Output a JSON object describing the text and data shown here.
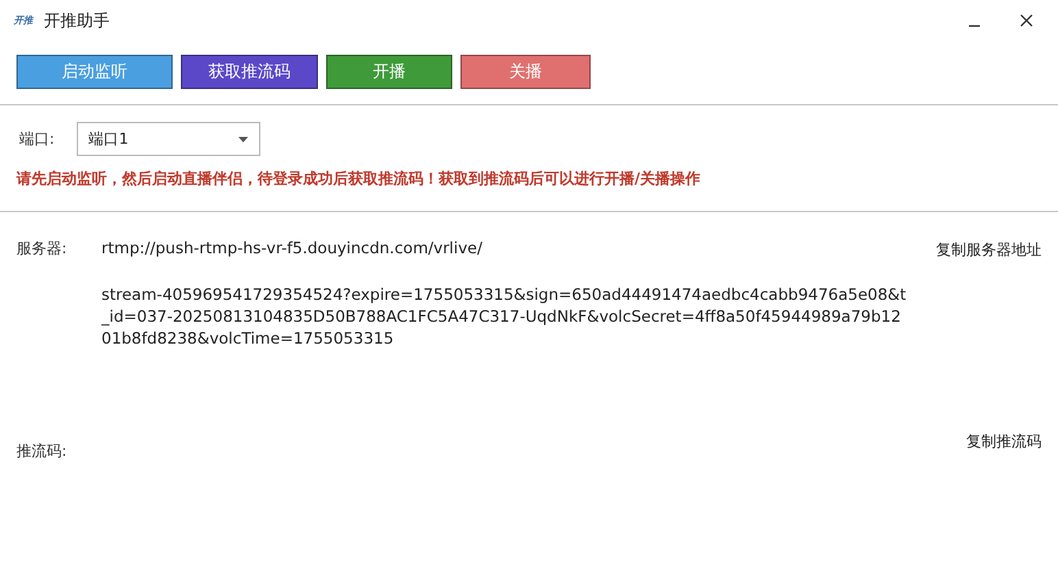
{
  "window": {
    "logo": "开推",
    "title": "开推助手"
  },
  "buttons": [
    {
      "label": "启动监听",
      "color": "#4a9fe0"
    },
    {
      "label": "获取推流码",
      "color": "#5a48c8"
    },
    {
      "label": "开播",
      "color": "#3f9a3a"
    },
    {
      "label": "关播",
      "color": "#e07070"
    }
  ],
  "port": {
    "label": "端口:",
    "value": "端口1"
  },
  "notice": "请先启动监听，然后启动直播伴侣，待登录成功后获取推流码！获取到推流码后可以进行开播/关播操作",
  "server": {
    "label": "服务器:",
    "value": "rtmp://push-rtmp-hs-vr-f5.douyincdn.com/vrlive/",
    "copy": "复制服务器地址"
  },
  "stream_lines": [
    "stream-405969541729354524?expire=1755053315&sign=650ad44491474aedbc4cabb9476a5e08&t",
    "_id=037-20250813104835D50B788AC1FC5A47C317-UqdNkF&volcSecret=4ff8a50f45944989a79b12",
    "01b8fd8238&volcTime=1755053315"
  ],
  "push_code": {
    "label": "推流码:",
    "copy": "复制推流码"
  }
}
